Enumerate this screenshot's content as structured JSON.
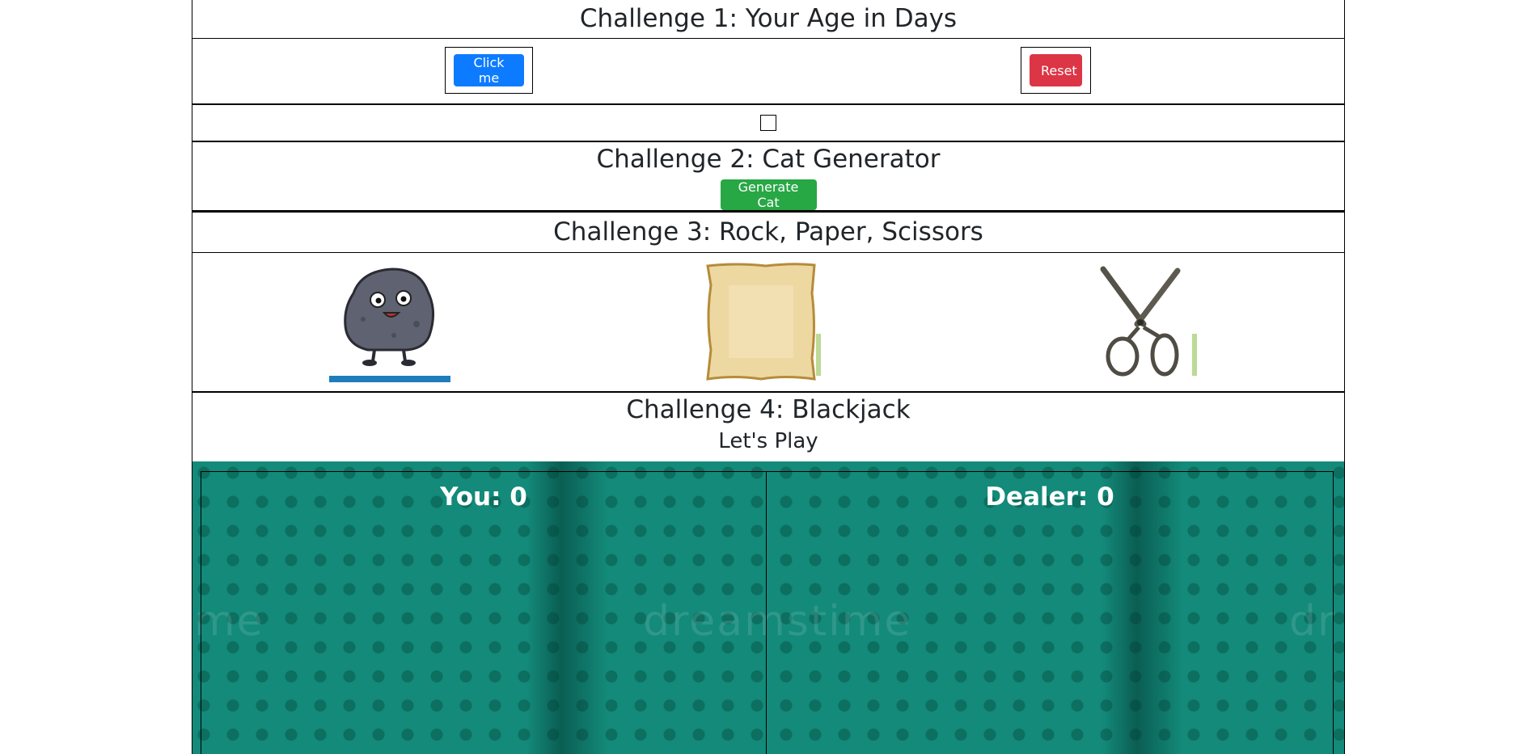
{
  "challenge1": {
    "title": "Challenge 1: Your Age in Days",
    "click_label": "Click me",
    "reset_label": "Reset"
  },
  "challenge2": {
    "title": "Challenge 2: Cat Generator",
    "button_label": "Generate Cat"
  },
  "challenge3": {
    "title": "Challenge 3: Rock, Paper, Scissors",
    "choices": [
      "rock-image",
      "paper-image",
      "scissors-image"
    ]
  },
  "challenge4": {
    "title": "Challenge 4: Blackjack",
    "subtitle": "Let's Play",
    "you_score": "You: 0",
    "dealer_score": "Dealer: 0",
    "watermark": "dreamstime"
  },
  "colors": {
    "primary": "#0d7bff",
    "danger": "#dc3545",
    "success": "#28a745",
    "table": "#138a7a"
  }
}
